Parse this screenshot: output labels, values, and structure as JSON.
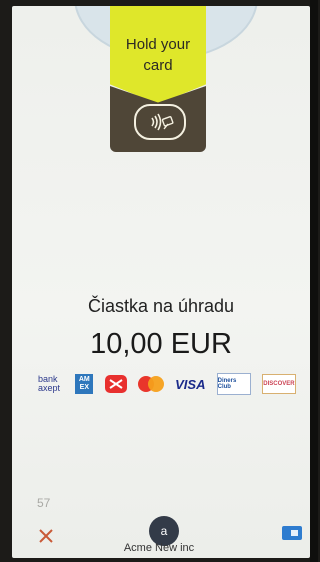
{
  "prompt": {
    "line1": "Hold your",
    "line2": "card",
    "icon": "contactless-card-icon"
  },
  "payment": {
    "label": "Čiastka na úhradu",
    "amount": "10,00 EUR"
  },
  "logos": {
    "bank_axept_line1": "bank",
    "bank_axept_line2": "axept",
    "amex": "AM EX",
    "visa": "VISA",
    "diners": "Diners Club",
    "discover": "DISCOVER"
  },
  "footer": {
    "counter": "57",
    "cancel_icon": "close-icon",
    "avatar_letter": "a",
    "merchant": "Acme New inc",
    "menu_icon": "menu-icon"
  },
  "colors": {
    "accent_yellow": "#dfe72a",
    "brown": "#4f4637",
    "cancel": "#c95a38",
    "blue": "#2e7ccf"
  }
}
